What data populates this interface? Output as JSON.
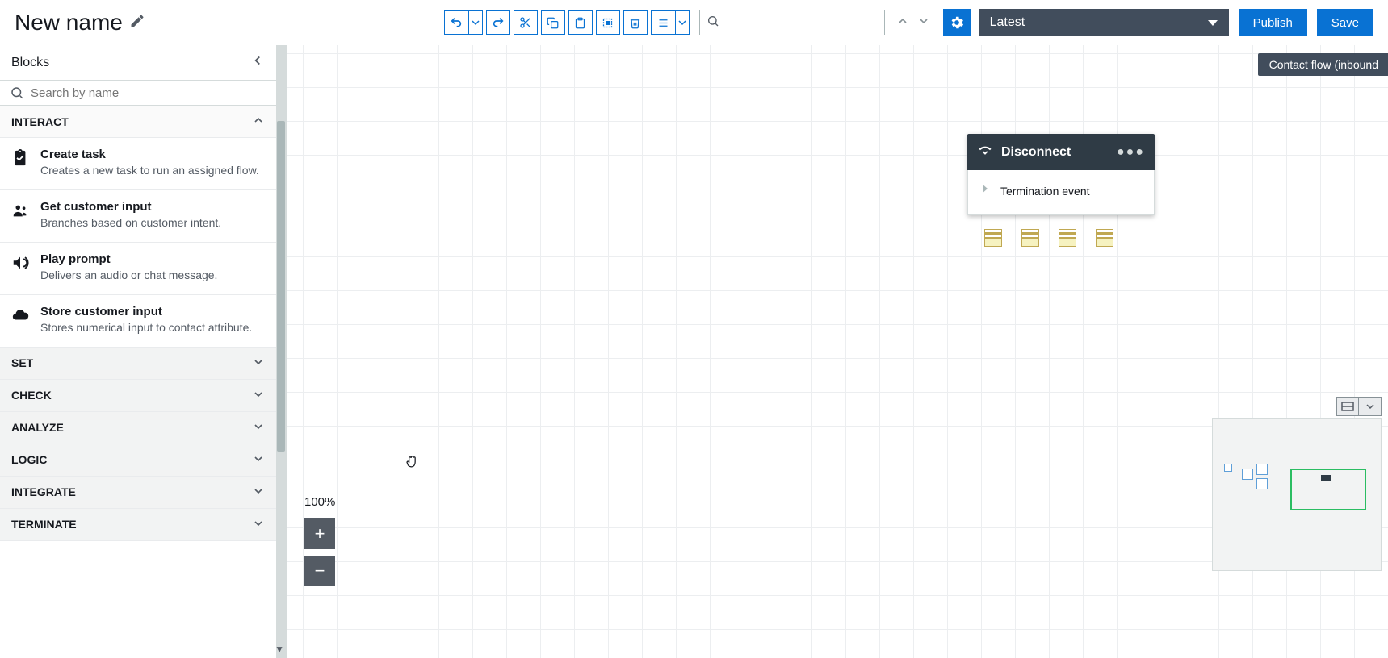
{
  "title": "New name",
  "version": "Latest",
  "publish_label": "Publish",
  "save_label": "Save",
  "flow_badge": "Contact flow (inbound",
  "sidebar": {
    "header": "Blocks",
    "search_placeholder": "Search by name",
    "categories": [
      {
        "name": "INTERACT",
        "open": true
      },
      {
        "name": "SET",
        "open": false
      },
      {
        "name": "CHECK",
        "open": false
      },
      {
        "name": "ANALYZE",
        "open": false
      },
      {
        "name": "LOGIC",
        "open": false
      },
      {
        "name": "INTEGRATE",
        "open": false
      },
      {
        "name": "TERMINATE",
        "open": false
      }
    ],
    "interact_blocks": [
      {
        "title": "Create task",
        "desc": "Creates a new task to run an assigned flow.",
        "icon": "clipboard-check-icon"
      },
      {
        "title": "Get customer input",
        "desc": "Branches based on customer intent.",
        "icon": "people-input-icon"
      },
      {
        "title": "Play prompt",
        "desc": "Delivers an audio or chat message.",
        "icon": "speaker-icon"
      },
      {
        "title": "Store customer input",
        "desc": "Stores numerical input to contact attribute.",
        "icon": "cloud-store-icon"
      }
    ]
  },
  "canvas": {
    "zoom_label": "100%",
    "node": {
      "title": "Disconnect",
      "event": "Termination event"
    }
  }
}
